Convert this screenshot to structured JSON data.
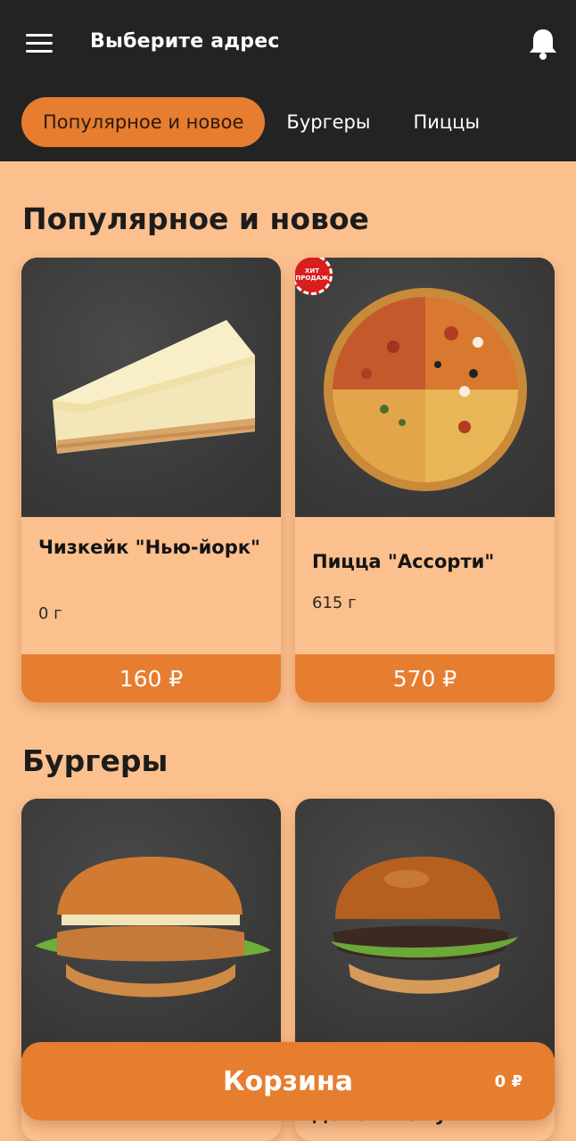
{
  "header": {
    "address_label": "Выберите адрес",
    "menu_icon": "menu-icon",
    "notification_icon": "bell-icon"
  },
  "tabs": [
    {
      "label": "Популярное и новое",
      "active": true
    },
    {
      "label": "Бургеры",
      "active": false
    },
    {
      "label": "Пиццы",
      "active": false
    }
  ],
  "sections": [
    {
      "title": "Популярное и новое",
      "products": [
        {
          "name": "Чизкейк \"Нью-йорк\"",
          "weight": "0 г",
          "price": "160 ₽",
          "badge": ""
        },
        {
          "name": "Пицца \"Ассорти\"",
          "weight": "615 г",
          "price": "570 ₽",
          "badge": "ХИТ ПРОДАЖ"
        }
      ]
    },
    {
      "title": "Бургеры",
      "products": [
        {
          "name": "",
          "weight": "",
          "price": ""
        },
        {
          "name": "домашнему",
          "weight": "",
          "price": ""
        }
      ]
    }
  ],
  "cart": {
    "label": "Корзина",
    "total": "0 ₽"
  },
  "colors": {
    "header_bg": "#232323",
    "accent": "#e77d2f",
    "page_bg": "#fcc08e"
  }
}
